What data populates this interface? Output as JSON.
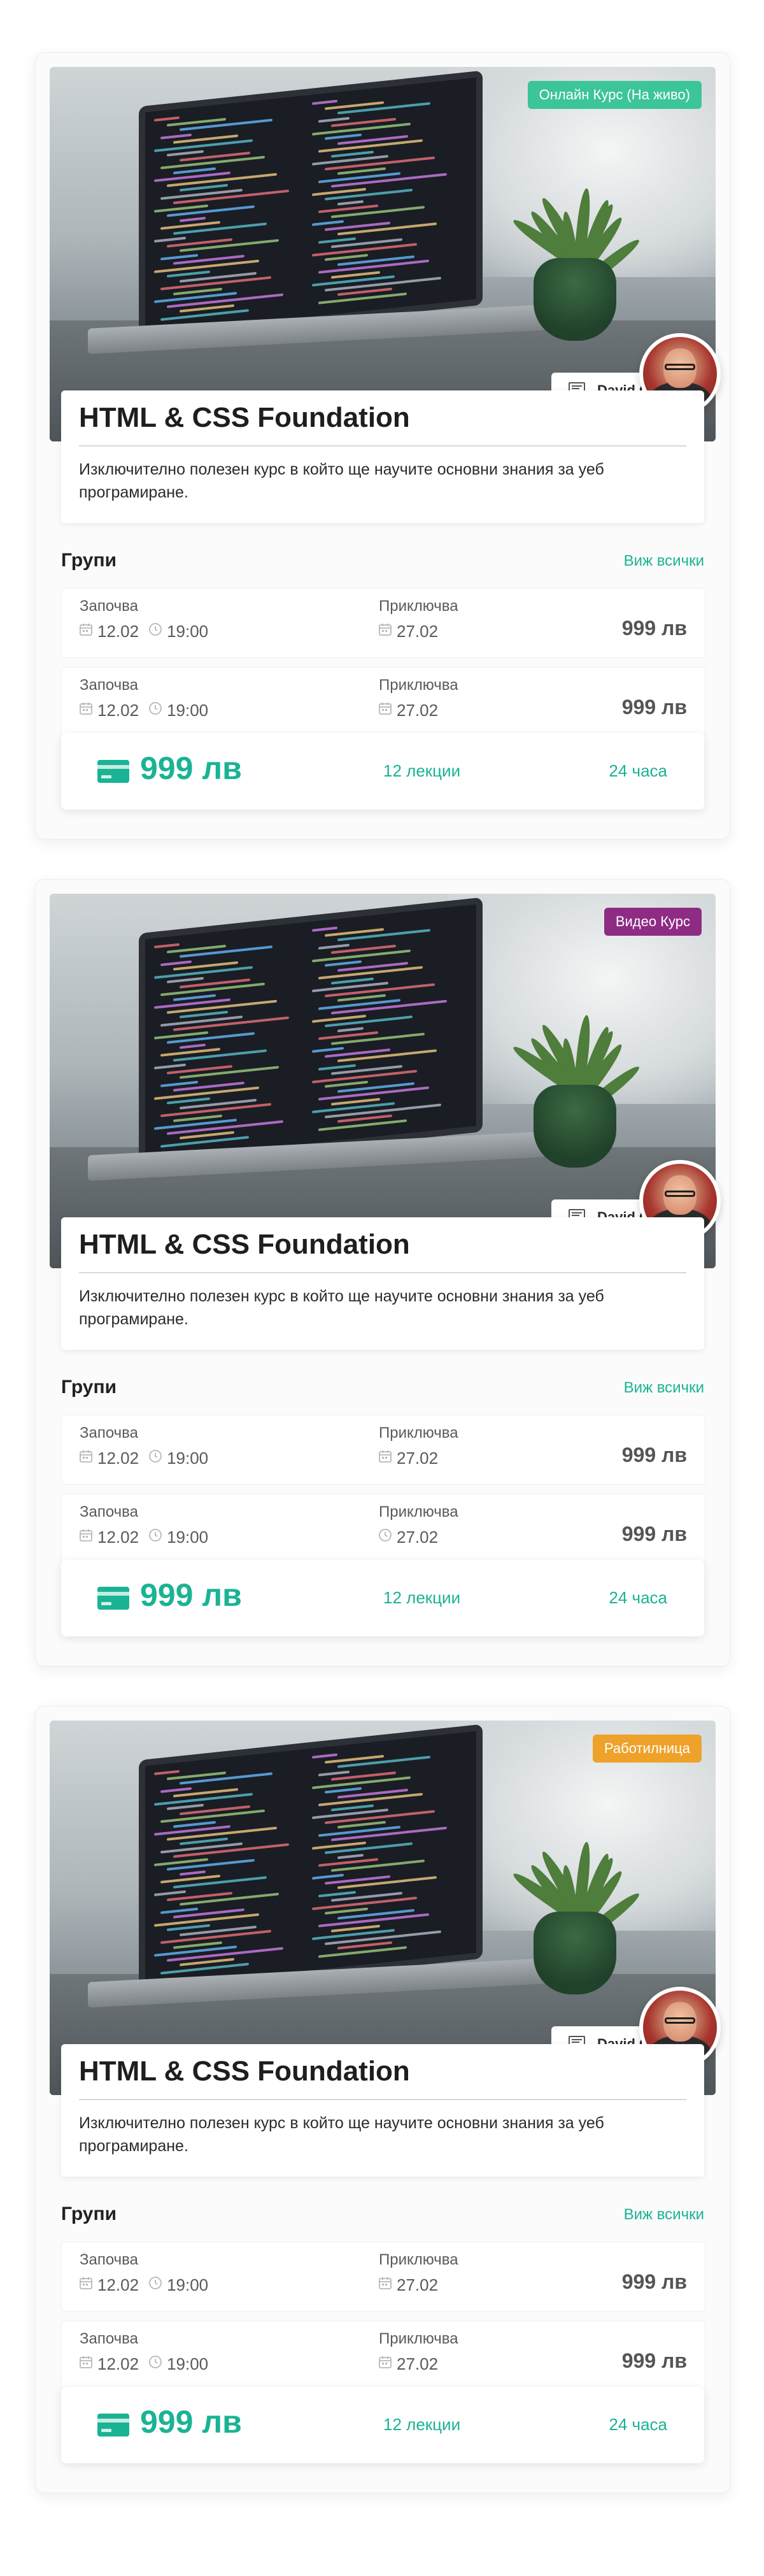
{
  "colors": {
    "accent": "#1ab394",
    "badge_online": "#3cc49b",
    "badge_video": "#8e2c84",
    "badge_workshop": "#eea22a"
  },
  "courses": [
    {
      "badge": "Онлайн Курс (На живо)",
      "badge_color": "#3cc49b",
      "teacher": "David Core",
      "title": "HTML & CSS Foundation",
      "description": "Изключително полезен курс в който ще научите основни знания за уеб програмиране.",
      "groups_title": "Групи",
      "groups_link": "Виж всички",
      "groups": [
        {
          "start_label": "Започва",
          "start_date": "12.02",
          "start_time": "19:00",
          "end_label": "Приключва",
          "end_date": "27.02",
          "end_icon": "calendar-icon",
          "price": "999 лв"
        },
        {
          "start_label": "Започва",
          "start_date": "12.02",
          "start_time": "19:00",
          "end_label": "Приключва",
          "end_date": "27.02",
          "end_icon": "calendar-icon",
          "price": "999 лв"
        }
      ],
      "price": "999 лв",
      "lectures": "12 лекции",
      "hours": "24 часа"
    },
    {
      "badge": "Видео Курс",
      "badge_color": "#8e2c84",
      "teacher": "David Core",
      "title": "HTML & CSS Foundation",
      "description": "Изключително полезен курс в който ще научите основни знания за уеб програмиране.",
      "groups_title": "Групи",
      "groups_link": "Виж всички",
      "groups": [
        {
          "start_label": "Започва",
          "start_date": "12.02",
          "start_time": "19:00",
          "end_label": "Приключва",
          "end_date": "27.02",
          "end_icon": "calendar-icon",
          "price": "999 лв"
        },
        {
          "start_label": "Започва",
          "start_date": "12.02",
          "start_time": "19:00",
          "end_label": "Приключва",
          "end_date": "27.02",
          "end_icon": "clock-icon",
          "price": "999 лв"
        }
      ],
      "price": "999 лв",
      "lectures": "12 лекции",
      "hours": "24 часа"
    },
    {
      "badge": "Работилница",
      "badge_color": "#eea22a",
      "teacher": "David Core",
      "title": "HTML & CSS Foundation",
      "description": "Изключително полезен курс в който ще научите основни знания за уеб програмиране.",
      "groups_title": "Групи",
      "groups_link": "Виж всички",
      "groups": [
        {
          "start_label": "Започва",
          "start_date": "12.02",
          "start_time": "19:00",
          "end_label": "Приключва",
          "end_date": "27.02",
          "end_icon": "calendar-icon",
          "price": "999 лв"
        },
        {
          "start_label": "Започва",
          "start_date": "12.02",
          "start_time": "19:00",
          "end_label": "Приключва",
          "end_date": "27.02",
          "end_icon": "calendar-icon",
          "price": "999 лв"
        }
      ],
      "price": "999 лв",
      "lectures": "12 лекции",
      "hours": "24 часа"
    }
  ]
}
